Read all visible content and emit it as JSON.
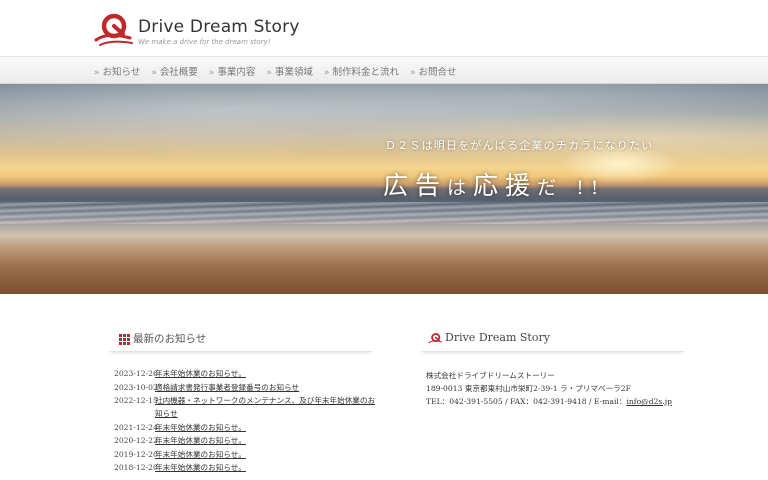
{
  "header": {
    "brand": "Drive Dream Story",
    "tagline": "We make a drive for the dream story!"
  },
  "nav": {
    "items": [
      {
        "label": "お知らせ"
      },
      {
        "label": "会社概要"
      },
      {
        "label": "事業内容"
      },
      {
        "label": "事業領域"
      },
      {
        "label": "制作料金と流れ"
      },
      {
        "label": "お問合せ"
      }
    ]
  },
  "hero": {
    "subtitle": "Ｄ２Ｓは明日をがんばる企業のチカラになりたい",
    "headline_1": "広告",
    "headline_2": "は",
    "headline_3": "応援",
    "headline_4": "だ !!"
  },
  "news": {
    "heading": "最新のお知らせ",
    "items": [
      {
        "date": "2023-12-26",
        "title": "年末年始休業のお知らせ。"
      },
      {
        "date": "2023-10-02",
        "title": "適格請求書発行事業者登録番号のお知らせ"
      },
      {
        "date": "2022-12-15",
        "title": "社内機器・ネットワークのメンテナンス、及び年末年始休業のお知らせ"
      },
      {
        "date": "2021-12-24",
        "title": "年末年始休業のお知らせ。"
      },
      {
        "date": "2020-12-22",
        "title": "年末年始休業のお知らせ。"
      },
      {
        "date": "2019-12-20",
        "title": "年末年始休業のお知らせ。"
      },
      {
        "date": "2018-12-20",
        "title": "年末年始休業のお知らせ。"
      }
    ]
  },
  "company": {
    "heading": "Drive Dream Story",
    "name": "株式会社ドライブドリームストーリー",
    "address": "189-0013 東京都東村山市栄町2-39-1 ラ・プリマベーラ2F",
    "contact_prefix": "TEL：042-391-5505 / FAX：042-391-9418 / E-mail：",
    "email": "info@d2s.jp"
  },
  "colors": {
    "brand_red": "#c0282c",
    "nav_text": "#777777"
  }
}
